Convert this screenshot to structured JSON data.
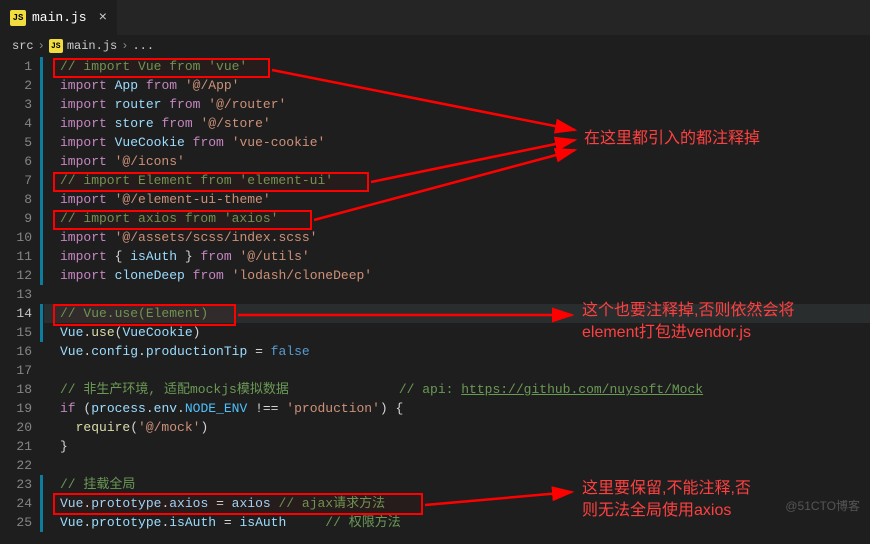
{
  "tab": {
    "icon_label": "JS",
    "filename": "main.js"
  },
  "breadcrumb": {
    "root": "src",
    "icon_label": "JS",
    "file": "main.js",
    "more": "..."
  },
  "lines": {
    "l1": "// import Vue from 'vue'",
    "l2a": "import",
    "l2b": "App",
    "l2c": "from",
    "l2d": "'@/App'",
    "l3a": "import",
    "l3b": "router",
    "l3c": "from",
    "l3d": "'@/router'",
    "l4a": "import",
    "l4b": "store",
    "l4c": "from",
    "l4d": "'@/store'",
    "l5a": "import",
    "l5b": "VueCookie",
    "l5c": "from",
    "l5d": "'vue-cookie'",
    "l6a": "import",
    "l6b": "'@/icons'",
    "l7": "// import Element from 'element-ui'",
    "l8a": "import",
    "l8b": "'@/element-ui-theme'",
    "l9": "// import axios from 'axios'",
    "l10a": "import",
    "l10b": "'@/assets/scss/index.scss'",
    "l11a": "import",
    "l11b": "{ ",
    "l11c": "isAuth",
    "l11d": " }",
    "l11e": "from",
    "l11f": "'@/utils'",
    "l12a": "import",
    "l12b": "cloneDeep",
    "l12c": "from",
    "l12d": "'lodash/cloneDeep'",
    "l14": "// Vue.use(Element)",
    "l15a": "Vue",
    "l15b": ".",
    "l15c": "use",
    "l15d": "(",
    "l15e": "VueCookie",
    "l15f": ")",
    "l16a": "Vue",
    "l16b": ".",
    "l16c": "config",
    "l16d": ".",
    "l16e": "productionTip",
    "l16f": " = ",
    "l16g": "false",
    "l18a": "// 非生产环境, 适配mockjs模拟数据",
    "l18b": "// api: ",
    "l18c": "https://github.com/nuysoft/Mock",
    "l19a": "if",
    "l19b": " (",
    "l19c": "process",
    "l19d": ".",
    "l19e": "env",
    "l19f": ".",
    "l19g": "NODE_ENV",
    "l19h": " !== ",
    "l19i": "'production'",
    "l19j": ") {",
    "l20a": "require",
    "l20b": "(",
    "l20c": "'@/mock'",
    "l20d": ")",
    "l21": "}",
    "l23": "// 挂载全局",
    "l24a": "Vue",
    "l24b": ".",
    "l24c": "prototype",
    "l24d": ".",
    "l24e": "axios",
    "l24f": " = ",
    "l24g": "axios",
    "l24h": " // ajax请求方法",
    "l25a": "Vue",
    "l25b": ".",
    "l25c": "prototype",
    "l25d": ".",
    "l25e": "isAuth",
    "l25f": " = ",
    "l25g": "isAuth",
    "l25h": "     // 权限方法"
  },
  "annot": {
    "a1": "在这里都引入的都注释掉",
    "a2_l1": "这个也要注释掉,否则依然会将",
    "a2_l2": "element打包进vendor.js",
    "a3_l1": "这里要保留,不能注释,否",
    "a3_l2": "则无法全局使用axios"
  },
  "watermark": "@51CTO博客"
}
